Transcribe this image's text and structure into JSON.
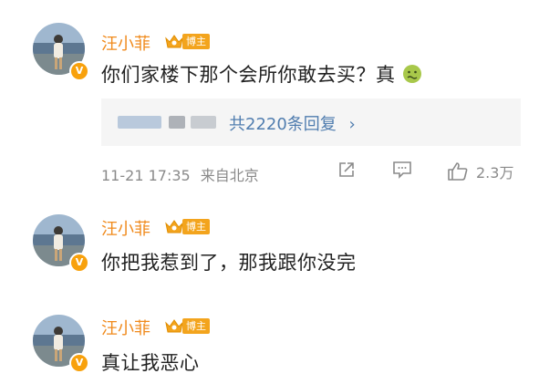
{
  "comments": [
    {
      "author": "汪小菲",
      "tag": "博主",
      "verified_badge": "V",
      "text": "你们家楼下那个会所你敢去买？真",
      "emoji": "nauseated-face",
      "reply_summary": "共2220条回复",
      "reply_arrow": "›",
      "timestamp": "11-21 17:35",
      "source": "来自北京",
      "like_count": "2.3万"
    },
    {
      "author": "汪小菲",
      "tag": "博主",
      "verified_badge": "V",
      "text": "你把我惹到了，那我跟你没完"
    },
    {
      "author": "汪小菲",
      "tag": "博主",
      "verified_badge": "V",
      "text": "真让我恶心"
    }
  ],
  "colors": {
    "name": "#f08a1c",
    "tag_bg": "#f3a41d",
    "link": "#507daf",
    "meta": "#8a8a8a",
    "reply_bg": "#f5f5f5"
  },
  "icons": [
    "share-icon",
    "comment-icon",
    "like-icon",
    "nauseated-face-icon",
    "crown-icon",
    "verified-badge-icon"
  ]
}
